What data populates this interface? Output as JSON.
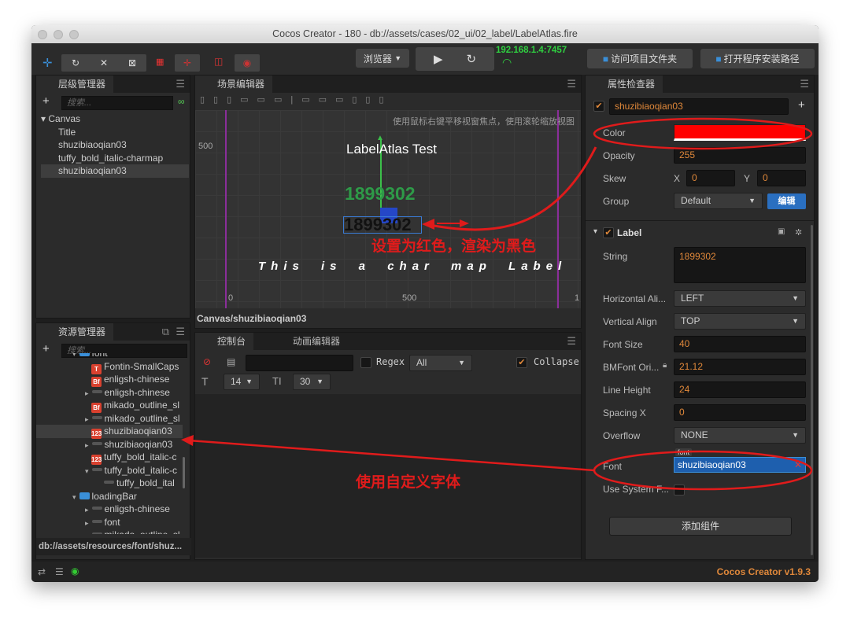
{
  "window": {
    "title": "Cocos Creator - 180 - db://assets/cases/02_ui/02_label/LabelAtlas.fire"
  },
  "toolbar": {
    "browser_label": "浏览器",
    "ip": "192.168.1.4:7457",
    "open_project": "访问项目文件夹",
    "open_install": "打开程序安装路径",
    "accent": "#3a8fd8"
  },
  "hierarchy": {
    "title": "层级管理器",
    "search_placeholder": "搜索...",
    "items": [
      "Canvas",
      "Title",
      "shuzibiaoqian03",
      "tuffy_bold_italic-charmap",
      "shuzibiaoqian03"
    ]
  },
  "assets": {
    "title": "资源管理器",
    "search_placeholder": "搜索...",
    "items": [
      {
        "label": "font",
        "icon": "folder"
      },
      {
        "label": "Fontin-SmallCaps",
        "icon": "T"
      },
      {
        "label": "enligsh-chinese",
        "icon": "Bf"
      },
      {
        "label": "enligsh-chinese",
        "icon": "bar"
      },
      {
        "label": "mikado_outline_sl",
        "icon": "Bf"
      },
      {
        "label": "mikado_outline_sl",
        "icon": "bar"
      },
      {
        "label": "shuzibiaoqian03",
        "icon": "123"
      },
      {
        "label": "shuzibiaoqian03",
        "icon": "bar"
      },
      {
        "label": "tuffy_bold_italic-c",
        "icon": "123"
      },
      {
        "label": "tuffy_bold_italic-c",
        "icon": "bar"
      },
      {
        "label": "tuffy_bold_ital",
        "icon": "bar"
      },
      {
        "label": "loadingBar",
        "icon": "folder"
      },
      {
        "label": "enligsh-chinese",
        "icon": "bar"
      },
      {
        "label": "font",
        "icon": "bar"
      },
      {
        "label": "mikado_outline_sl",
        "icon": "bar"
      }
    ],
    "path": "db://assets/resources/font/shuz..."
  },
  "scene": {
    "title": "场景编辑器",
    "hint": "使用鼠标右键平移视窗焦点，使用滚轮缩放视图",
    "y_label": "500",
    "x_labels": [
      "0",
      "500",
      "1"
    ],
    "title_text": "LabelAtlas Test",
    "green_number": "1899302",
    "black_number": "1899302",
    "charmap_text": "This is a char map Label",
    "breadcrumb": "Canvas/shuzibiaoqian03"
  },
  "console": {
    "tab_console": "控制台",
    "tab_anim": "动画编辑器",
    "regex": "Regex",
    "filter": "All",
    "collapse": "Collapse",
    "font_size": "14",
    "line_height": "30"
  },
  "inspector": {
    "title": "属性检查器",
    "node_name": "shuzibiaoqian03",
    "color_label": "Color",
    "color_value": "#ff0000",
    "opacity_label": "Opacity",
    "opacity": "255",
    "skew_label": "Skew",
    "skew_x": "0",
    "skew_y": "0",
    "x": "X",
    "y": "Y",
    "group_label": "Group",
    "group": "Default",
    "edit_btn": "编辑",
    "component": "Label",
    "string_label": "String",
    "string": "1899302",
    "halign_label": "Horizontal Ali...",
    "halign": "LEFT",
    "valign_label": "Vertical Align",
    "valign": "TOP",
    "fontsize_label": "Font Size",
    "fontsize": "40",
    "bmfont_label": "BMFont Ori...",
    "bmfont": "21.12",
    "lineheight_label": "Line Height",
    "lineheight": "24",
    "spacing_label": "Spacing X",
    "spacing": "0",
    "overflow_label": "Overflow",
    "overflow": "NONE",
    "font_label": "Font",
    "font_tag": "font",
    "font": "shuzibiaoqian03",
    "sysfont_label": "Use System F...",
    "add_component": "添加组件"
  },
  "status": {
    "version": "Cocos Creator v1.9.3"
  },
  "annotations": {
    "note_color": "设置为红色，渲染为黑色",
    "note_font": "使用自定义字体",
    "color": "#e01b1b"
  }
}
